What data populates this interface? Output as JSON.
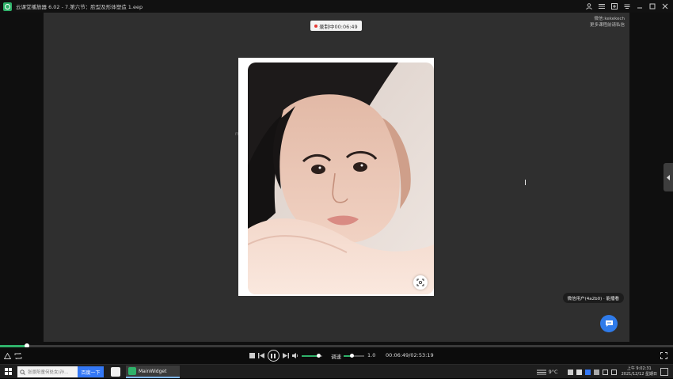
{
  "window": {
    "title": "云课堂播放器 6.02 - 7.第六节：脸型及形体塑造 1.eep"
  },
  "stage": {
    "recording_badge": "录制中00:06:49",
    "watermark_top_line1": "微信:kekekech",
    "watermark_top_line2": "更多课程前请私信",
    "watermark_left": "rr60000",
    "viewer_badge": "微信用户(4a2b0) · 能播看"
  },
  "player": {
    "progress_fraction": 0.04,
    "volume_fraction": 0.8,
    "speed_label": "调速",
    "speed_fraction": 0.4,
    "speed_value": "1.0",
    "time_display": "00:06:49/02:53:19"
  },
  "taskbar": {
    "search_placeholder": "张景阳童何处女(孙...",
    "search_button": "百度一下",
    "active_app": "MainWidget",
    "temperature": "9°C",
    "time": "上午 9:02:31",
    "date": "2021/12/12 星期日"
  },
  "colors": {
    "accent_green": "#2fb26a",
    "chat_blue": "#2f7bea",
    "record_red": "#e53935"
  }
}
